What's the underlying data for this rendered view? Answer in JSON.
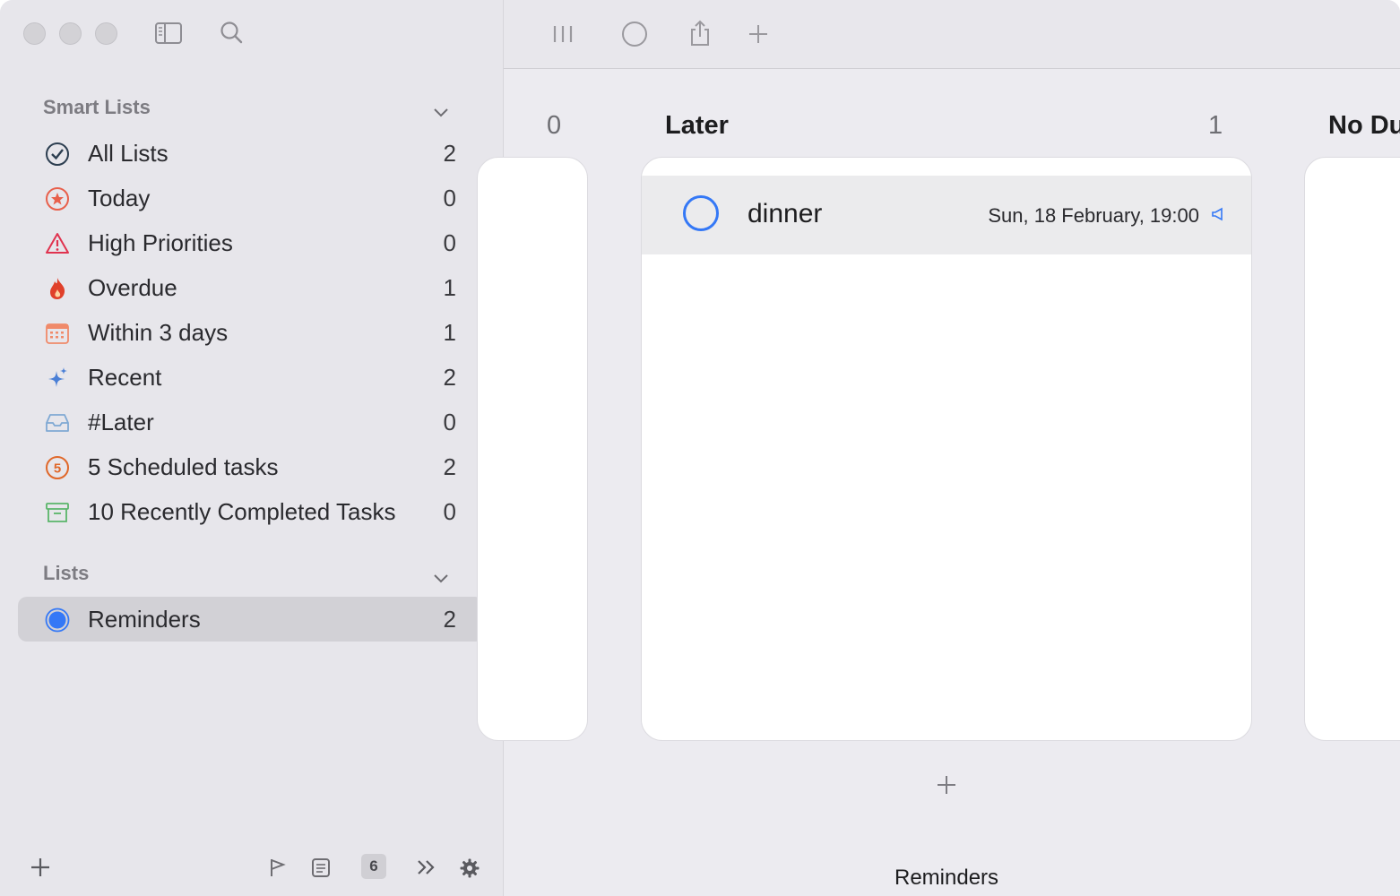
{
  "sidebar": {
    "smart_lists_title": "Smart Lists",
    "lists_title": "Lists",
    "smart_items": [
      {
        "label": "All Lists",
        "count": "2",
        "icon": "checkmark-circle-icon",
        "color": "#2c3e50"
      },
      {
        "label": "Today",
        "count": "0",
        "icon": "star-circle-icon",
        "color": "#e8604c"
      },
      {
        "label": "High Priorities",
        "count": "0",
        "icon": "warning-triangle-icon",
        "color": "#e0334f"
      },
      {
        "label": "Overdue",
        "count": "1",
        "icon": "flame-icon",
        "color": "#e0402a"
      },
      {
        "label": "Within 3 days",
        "count": "1",
        "icon": "calendar-icon",
        "color": "#f08a6a"
      },
      {
        "label": "Recent",
        "count": "2",
        "icon": "sparkles-icon",
        "color": "#4a7fd6"
      },
      {
        "label": "#Later",
        "count": "0",
        "icon": "tray-icon",
        "color": "#7fa9d4"
      },
      {
        "label": "5 Scheduled tasks",
        "count": "2",
        "icon": "number-five-circle-icon",
        "color": "#e0682a"
      },
      {
        "label": "10 Recently Completed Tasks",
        "count": "0",
        "icon": "archive-box-icon",
        "color": "#5ab56a"
      }
    ],
    "lists": [
      {
        "label": "Reminders",
        "count": "2",
        "icon": "filled-circle-icon",
        "color": "#3478f6"
      }
    ],
    "bottom_badge": "6"
  },
  "board": {
    "left_column_count": "0",
    "later_column_title": "Later",
    "later_column_count": "1",
    "right_column_title": "No Du",
    "task": {
      "title": "dinner",
      "date": "Sun, 18 February, 19:00"
    },
    "footer_label": "Reminders"
  },
  "colors": {
    "accent": "#3478f6",
    "sidebar_bg": "#e7e6eb",
    "selected_row": "#d2d1d6"
  }
}
